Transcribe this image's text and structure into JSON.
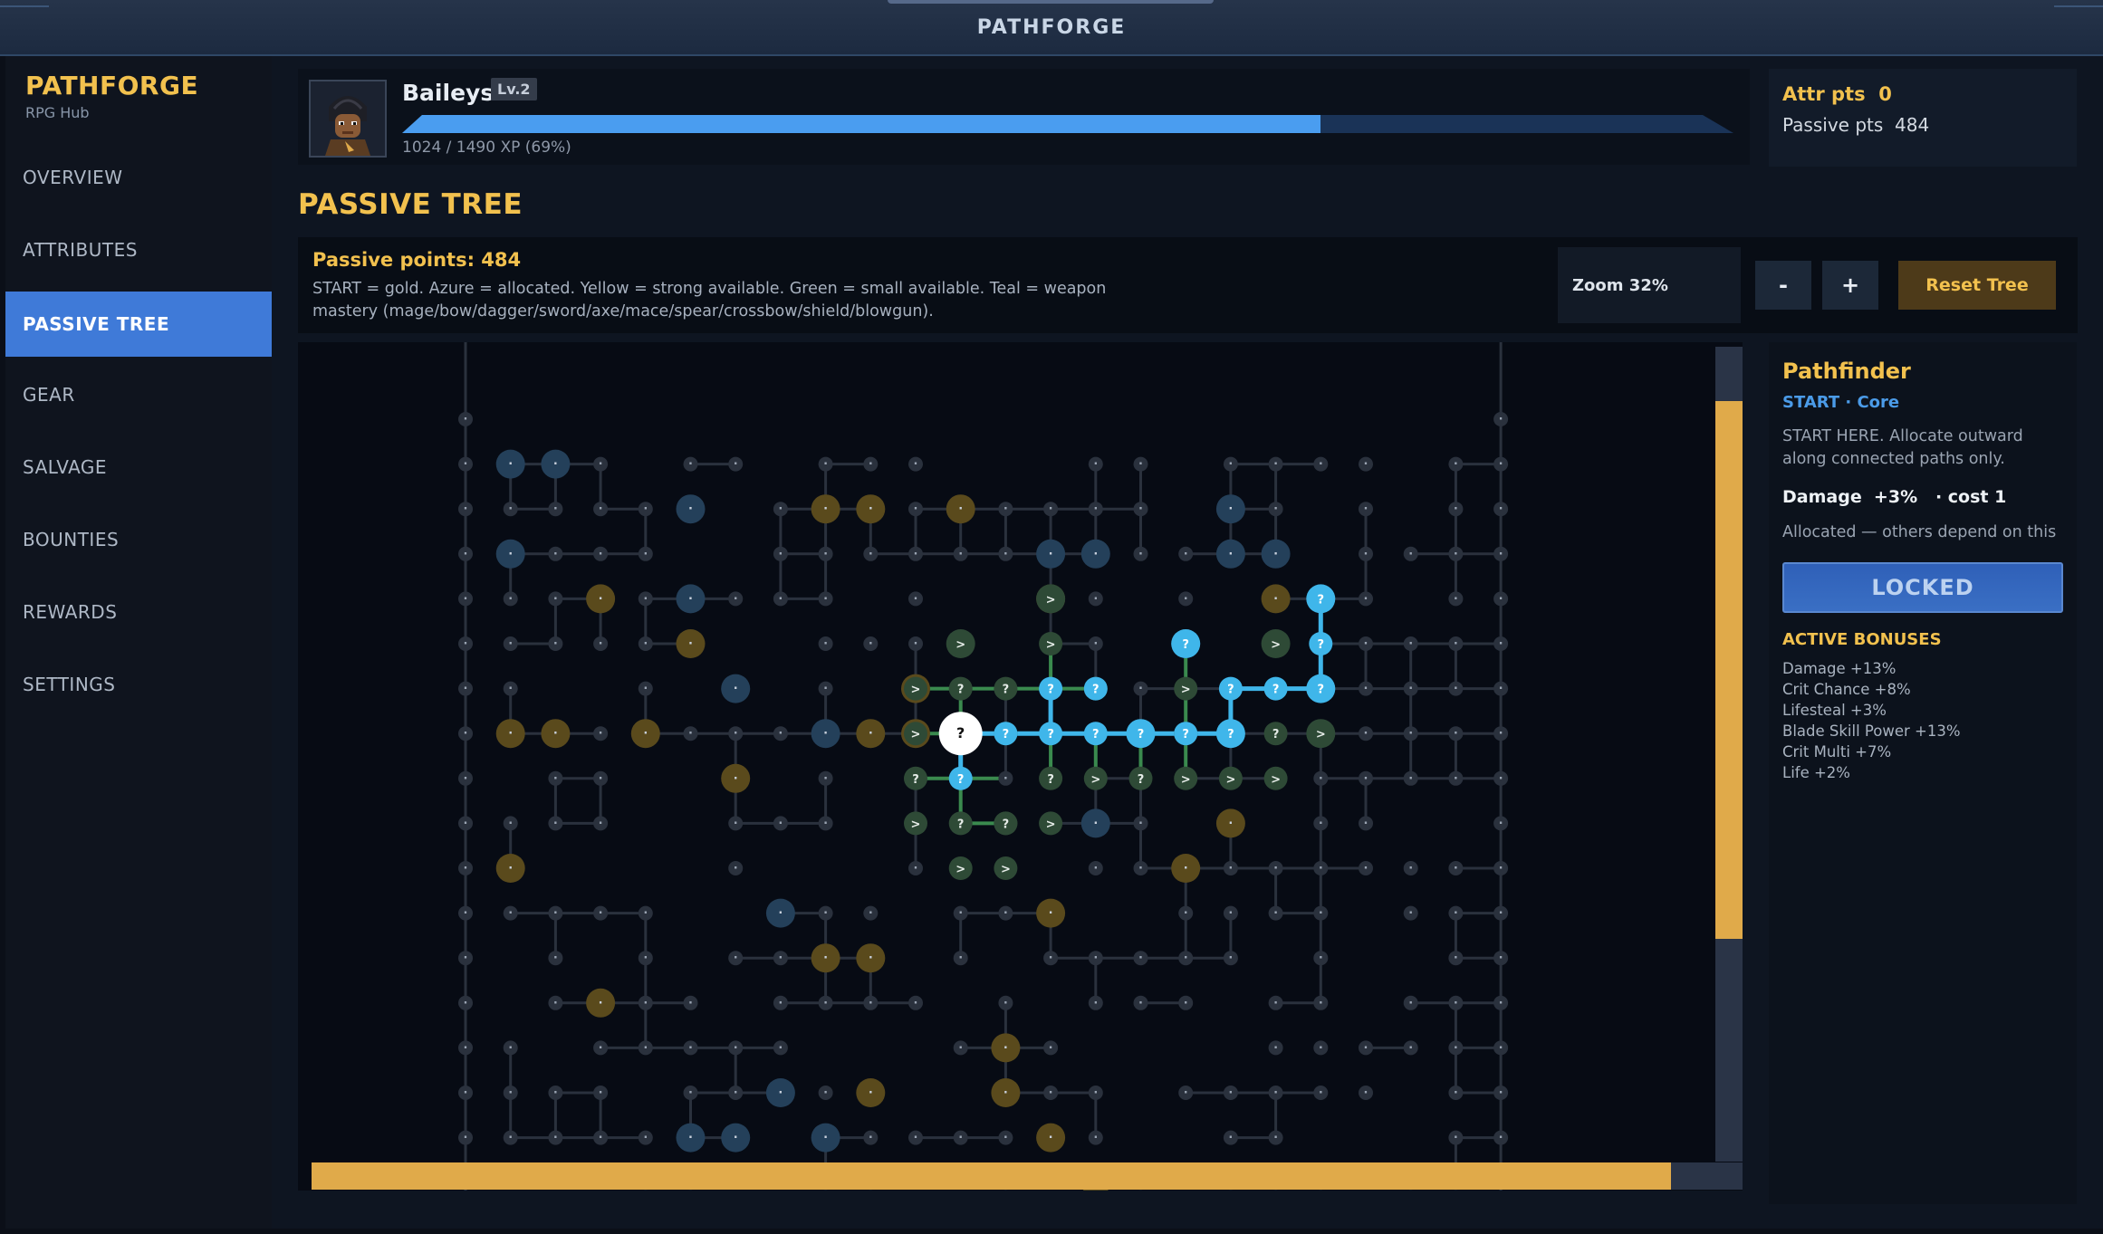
{
  "window": {
    "title": "PATHFORGE"
  },
  "brand": {
    "name": "PATHFORGE",
    "subtitle": "RPG Hub"
  },
  "nav": {
    "items": [
      {
        "label": "OVERVIEW",
        "active": false
      },
      {
        "label": "ATTRIBUTES",
        "active": false
      },
      {
        "label": "PASSIVE TREE",
        "active": true
      },
      {
        "label": "GEAR",
        "active": false
      },
      {
        "label": "SALVAGE",
        "active": false
      },
      {
        "label": "BOUNTIES",
        "active": false
      },
      {
        "label": "REWARDS",
        "active": false
      },
      {
        "label": "SETTINGS",
        "active": false
      }
    ]
  },
  "player": {
    "name": "Baileys",
    "level": "Lv.2",
    "xp_text": "1024 / 1490 XP (69%)",
    "xp_fraction": 0.69
  },
  "points": {
    "attr_label": "Attr pts",
    "attr_value": "0",
    "passive_label": "Passive pts",
    "passive_value": "484"
  },
  "section": {
    "title": "PASSIVE TREE"
  },
  "info": {
    "passive_points": "Passive points: 484",
    "legend": "START = gold. Azure = allocated. Yellow = strong available. Green = small available. Teal = weapon mastery (mage/bow/dagger/sword/axe/mace/spear/crossbow/shield/blowgun)."
  },
  "controls": {
    "zoom": "Zoom 32%",
    "minus": "-",
    "plus": "+",
    "reset": "Reset Tree"
  },
  "detail": {
    "name": "Pathfinder",
    "tag": "START · Core",
    "description": "START HERE. Allocate outward along connected paths only.",
    "stat": "Damage  +3%   · cost 1",
    "note": "Allocated — others depend on this",
    "button": "LOCKED",
    "bonuses_title": "ACTIVE BONUSES",
    "bonuses": [
      "Damage  +13%",
      "Crit Chance  +8%",
      "Lifesteal  +3%",
      "Blade Skill Power  +13%",
      "Crit Multi  +7%",
      "Life  +2%"
    ]
  },
  "tree": {
    "node_marks": {
      "dot": "·",
      "unknown": "?",
      "path": ">"
    },
    "colors": {
      "start": "#ffffff",
      "allocated": "#3fb6ea",
      "strong": "#5a4a1c",
      "small": "#2e4a36",
      "mastery": "#24405a",
      "minor": "#2a313d"
    },
    "scroll": {
      "vertical_fraction": 0.66,
      "horizontal_fraction": 0.95
    }
  }
}
